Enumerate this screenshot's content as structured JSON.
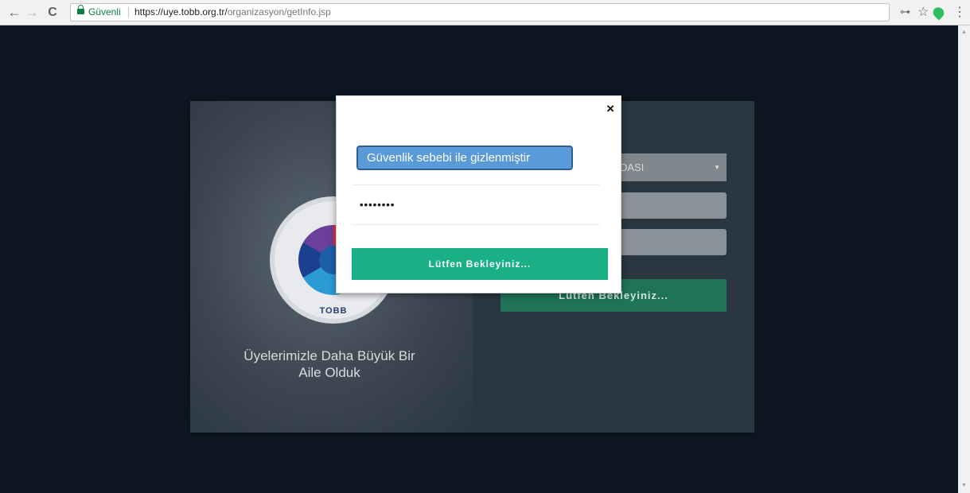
{
  "browser": {
    "secure_label": "Güvenli",
    "url_host": "https://uye.tobb.org.tr/",
    "url_path": "organizasyon/getInfo.jsp",
    "icons": {
      "back": "←",
      "forward": "→",
      "reload": "C",
      "key": "⊶",
      "star": "☆",
      "menu": "⋮"
    }
  },
  "login_card": {
    "hero_caption_line1": "Üyelerimizle Daha Büyük Bir",
    "hero_caption_line2": "Aile Olduk",
    "logo_text": "TOBB",
    "logo_ring_text": "TÜRKİYE ODALAR VE BORSALAR BİRLİĞİ",
    "select_value": "DASI",
    "submit_label": "Lütfen Bekleyiniz..."
  },
  "modal": {
    "close_icon": "×",
    "banner_text": "Güvenlik sebebi ile gizlenmiştir",
    "password_value": "••••••••",
    "submit_label": "Lütfen Bekleyiniz..."
  },
  "colors": {
    "page_bg": "#0e1822",
    "card_bg": "#2a3640",
    "modal_submit": "#1aaf84",
    "banner": "#5a9ad8",
    "secure": "#0b8043"
  }
}
